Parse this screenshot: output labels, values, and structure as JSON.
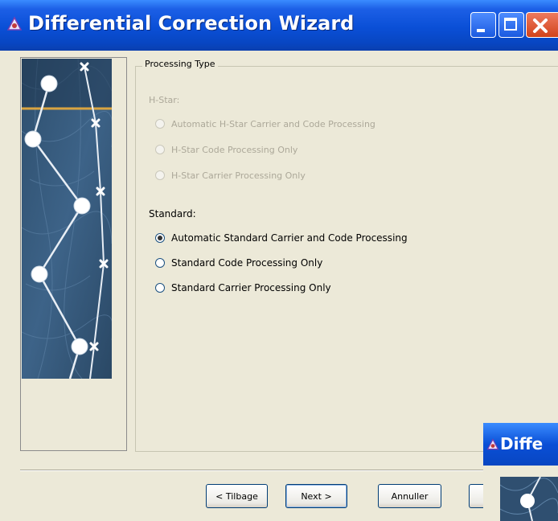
{
  "window": {
    "title": "Differential Correction Wizard",
    "icon": "trimble-pathfinder-icon",
    "controls": [
      "minimize-icon",
      "maximize-icon",
      "close-icon"
    ]
  },
  "group": {
    "legend": "Processing Type",
    "hstar": {
      "label": "H-Star:",
      "options": [
        {
          "label": "Automatic H-Star Carrier and Code Processing",
          "checked": false,
          "enabled": false
        },
        {
          "label": "H-Star Code Processing Only",
          "checked": false,
          "enabled": false
        },
        {
          "label": "H-Star Carrier Processing Only",
          "checked": false,
          "enabled": false
        }
      ]
    },
    "standard": {
      "label": "Standard:",
      "options": [
        {
          "label": "Automatic Standard Carrier and Code Processing",
          "checked": true,
          "enabled": true
        },
        {
          "label": "Standard Code Processing Only",
          "checked": false,
          "enabled": true
        },
        {
          "label": "Standard Carrier Processing Only",
          "checked": false,
          "enabled": true
        }
      ]
    }
  },
  "buttons": {
    "back": "< Tilbage",
    "next": "Next  >",
    "cancel": "Annuller"
  },
  "overlay_window": {
    "title": "Diffe"
  },
  "colors": {
    "titlebar": "#0a4fd6",
    "window_bg": "#ece9d8",
    "close_button": "#d2431b",
    "disabled_text": "#aca899"
  }
}
